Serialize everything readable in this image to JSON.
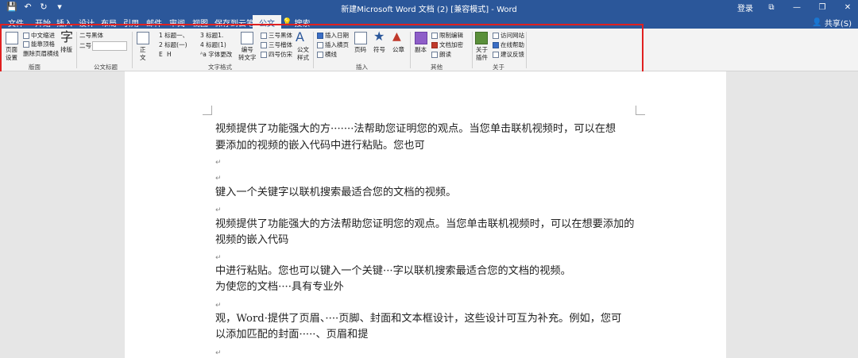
{
  "titlebar": {
    "qat": [
      "💾",
      "↶ ▾",
      "↻",
      "▾"
    ],
    "title": "新建Microsoft Word 文档 (2) [兼容模式] - Word",
    "login": "登录",
    "win_buttons": [
      "⧉",
      "—",
      "❐",
      "✕"
    ]
  },
  "tabs": [
    "文件",
    "开始",
    "插入",
    "设计",
    "布局",
    "引用",
    "邮件",
    "审阅",
    "视图",
    "保存到云笔记",
    "公文"
  ],
  "active_tab": "公文",
  "tell_me": {
    "icon": "💡",
    "label": "搜索"
  },
  "share": {
    "icon": "👤",
    "label": "共享(S)"
  },
  "ribbon": {
    "page_setup": "页面\n设置",
    "chinese_indent": "中文缩进",
    "header_top": "能靠顶格",
    "remove_header_line": "删除页眉横线",
    "typeset_glyph": "字",
    "typeset": "排版",
    "font_name": "二号黑体",
    "font_size": "二号",
    "body_text": "正\n文",
    "heading1": "1 标题一、",
    "heading2": "2 标题(一)",
    "heading_e": "E",
    "heading_h": "H",
    "heading3": "3 标题1.",
    "heading4": "4 标题(1)",
    "font_change": "字体更改",
    "number_to_text": "编号\n转文字",
    "heiti": "三号黑体",
    "kaiti": "三号楷体",
    "fangsong": "四号仿宋",
    "doc_style": "公文\n样式",
    "insert_date": "插入日期",
    "insert_footer": "插入横页",
    "separator_line": "横线",
    "page_number": "页码",
    "symbol": "符号",
    "seal": "公章",
    "copy": "副本",
    "restrict_edit": "限制编辑",
    "doc_encrypt": "文档加密",
    "read_aloud": "朗读",
    "about_plugin": "关于\n插件",
    "visit_site": "访问网站",
    "online_help": "在线帮助",
    "feedback": "建议反馈",
    "groups": {
      "layout": "版面",
      "doc_title": "公文标题",
      "text_format": "文字格式",
      "insert": "插入",
      "other": "其他",
      "about": "关于"
    }
  },
  "document": {
    "lines": [
      "视频提供了功能强大的方·······法帮助您证明您的观点。当您单击联机视频时，可以在想",
      "要添加的视频的嵌入代码中进行粘贴。您也可",
      "键入一个关键字以联机搜索最适合您的文档的视频。",
      "视频提供了功能强大的方法帮助您证明您的观点。当您单击联机视频时，可以在想要添加的",
      "视频的嵌入代码",
      "中进行粘贴。您也可以键入一个关键···字以联机搜索最适合您的文档的视频。",
      "为使您的文档····具有专业外",
      "观，Word·提供了页眉、····页脚、封面和文本框设计，这些设计可互为补充。例如，您可",
      "以添加匹配的封面·····、页眉和提"
    ],
    "para_mark": "↵"
  }
}
